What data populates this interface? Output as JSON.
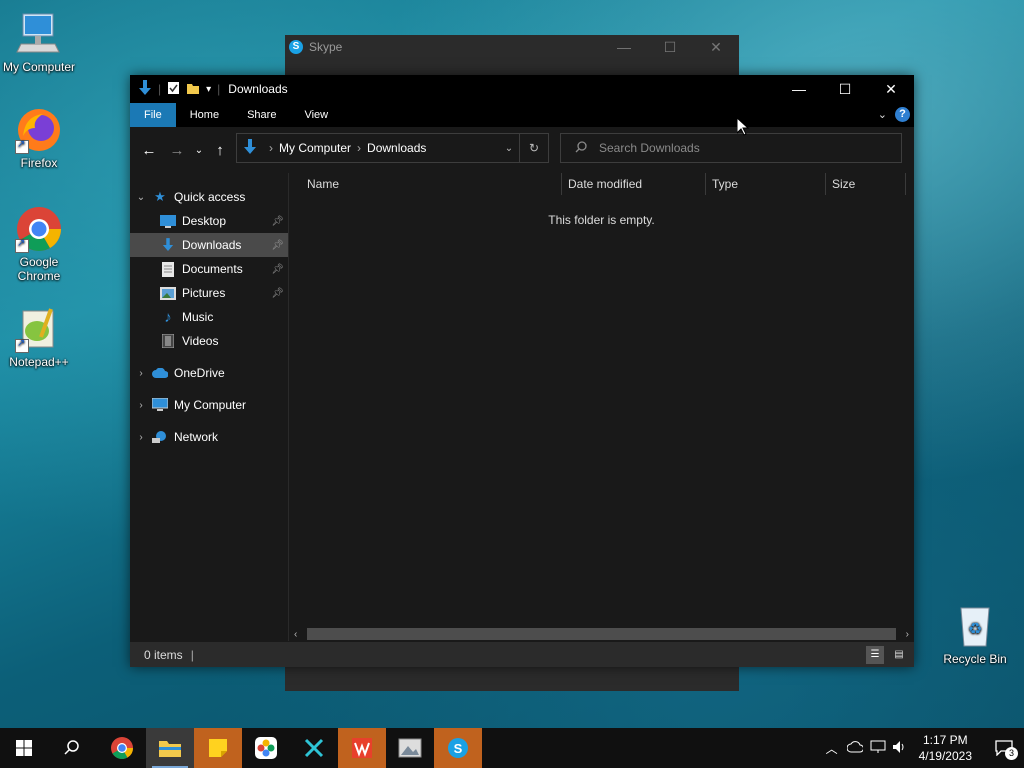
{
  "desktop": {
    "icons": [
      {
        "label": "My Computer"
      },
      {
        "label": "Firefox"
      },
      {
        "label": "Google\nChrome"
      },
      {
        "label": "Notepad++"
      },
      {
        "label": "Recycle Bin"
      }
    ]
  },
  "skype": {
    "title": "Skype"
  },
  "explorer": {
    "title": "Downloads",
    "tabs": [
      "File",
      "Home",
      "Share",
      "View"
    ],
    "address": {
      "crumbs": [
        "My Computer",
        "Downloads"
      ]
    },
    "search": {
      "placeholder": "Search Downloads"
    },
    "nav": {
      "quick_access": "Quick access",
      "items": [
        "Desktop",
        "Downloads",
        "Documents",
        "Pictures",
        "Music",
        "Videos"
      ],
      "onedrive": "OneDrive",
      "mycomputer": "My Computer",
      "network": "Network"
    },
    "columns": [
      "Name",
      "Date modified",
      "Type",
      "Size"
    ],
    "empty_text": "This folder is empty.",
    "status": "0 items"
  },
  "taskbar": {
    "time": "1:17 PM",
    "date": "4/19/2023",
    "notifications": "3"
  }
}
